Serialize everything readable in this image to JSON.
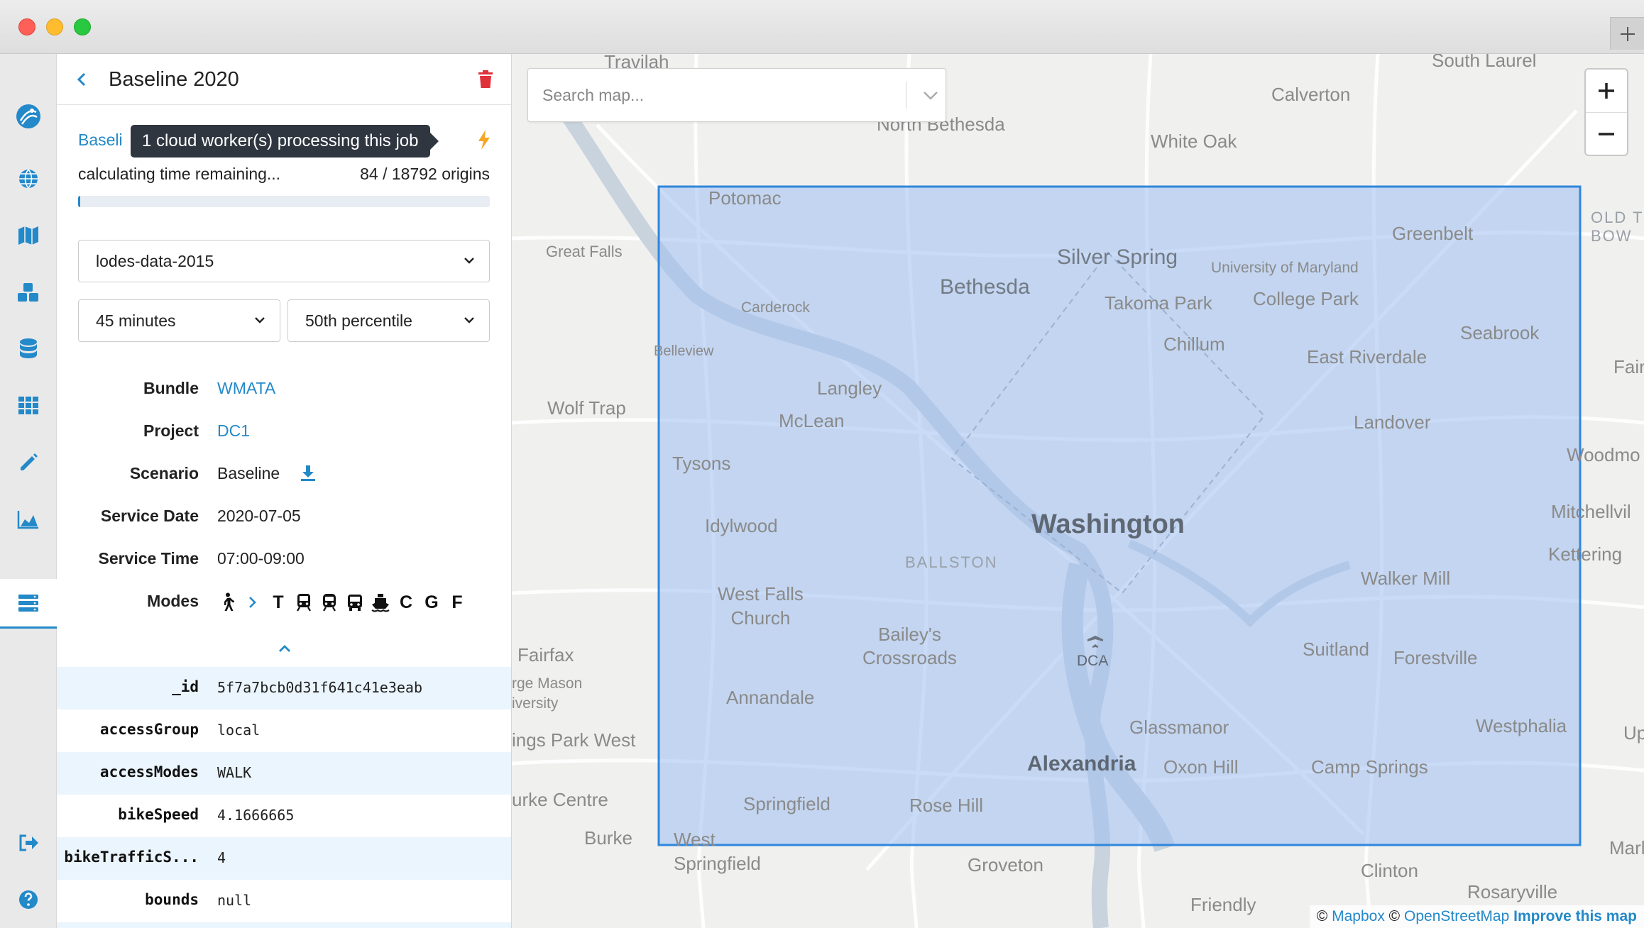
{
  "colors": {
    "accent": "#2389c9",
    "danger": "#e0303a",
    "bolt": "#f5a623",
    "region_fill": "#9ec0f2",
    "region_stroke": "#2f86dd"
  },
  "sidebar": {
    "items": [
      {
        "name": "logo",
        "icon": "logo-icon"
      },
      {
        "name": "regions",
        "icon": "globe-icon"
      },
      {
        "name": "map",
        "icon": "map-icon"
      },
      {
        "name": "bundles",
        "icon": "cubes-icon"
      },
      {
        "name": "database",
        "icon": "database-icon"
      },
      {
        "name": "grid",
        "icon": "grid-icon"
      },
      {
        "name": "edit",
        "icon": "pencil-icon"
      },
      {
        "name": "analysis",
        "icon": "area-chart-icon"
      },
      {
        "name": "jobs",
        "icon": "server-icon",
        "active": true
      },
      {
        "name": "logout",
        "icon": "sign-out-icon"
      },
      {
        "name": "help",
        "icon": "question-circle-icon"
      }
    ]
  },
  "job": {
    "title": "Baseline 2020",
    "link_text": "Baseli",
    "tooltip": "1 cloud worker(s) processing this job",
    "progress_text": "calculating time remaining...",
    "progress_count": "84 / 18792 origins",
    "progress_fraction": 0.0045,
    "opportunity_select": "lodes-data-2015",
    "time_cutoff_select": "45 minutes",
    "percentile_select": "50th percentile"
  },
  "details": {
    "bundle_label": "Bundle",
    "bundle_value": "WMATA",
    "project_label": "Project",
    "project_value": "DC1",
    "scenario_label": "Scenario",
    "scenario_value": "Baseline",
    "service_date_label": "Service Date",
    "service_date_value": "2020-07-05",
    "service_time_label": "Service Time",
    "service_time_value": "07:00-09:00",
    "modes_label": "Modes",
    "modes": [
      "T",
      "C",
      "G",
      "F"
    ]
  },
  "properties": [
    {
      "key": "_id",
      "value": "5f7a7bcb0d31f641c41e3eab"
    },
    {
      "key": "accessGroup",
      "value": "local"
    },
    {
      "key": "accessModes",
      "value": "WALK"
    },
    {
      "key": "bikeSpeed",
      "value": "4.1666665"
    },
    {
      "key": "bikeTrafficS...",
      "value": "4"
    },
    {
      "key": "bounds",
      "value": "null"
    }
  ],
  "map": {
    "search_placeholder": "Search map...",
    "zoom_in": "+",
    "zoom_out": "−",
    "attribution": {
      "c1": "©",
      "mapbox": "Mapbox",
      "c2": "©",
      "osm": "OpenStreetMap",
      "improve": "Improve this map"
    },
    "labels": {
      "travilah": "Travilah",
      "north_bethesda": "North Bethesda",
      "calverton": "Calverton",
      "south_laurel": "South Laurel",
      "white_oak": "White Oak",
      "potomac": "Potomac",
      "great_falls": "Great Falls",
      "silver_spring": "Silver Spring",
      "greenbelt": "Greenbelt",
      "old_town_bowie": "OLD T\nBOW",
      "bethesda": "Bethesda",
      "umd": "University of Maryland",
      "takoma_park": "Takoma Park",
      "college_park": "College Park",
      "carderock": "Carderock",
      "chillum": "Chillum",
      "seabrook": "Seabrook",
      "bellevieew": "Belleview",
      "east_riverdale": "East Riverdale",
      "fair": "Fair",
      "langley": "Langley",
      "wolf_trap": "Wolf Trap",
      "mclean": "McLean",
      "landover": "Landover",
      "tysons": "Tysons",
      "woodmo": "Woodmo",
      "mitchellvil": "Mitchellvil",
      "idylwood": "Idylwood",
      "washington": "Washington",
      "ballston": "BALLSTON",
      "kettering": "Kettering",
      "walker_mill": "Walker Mill",
      "west_falls_church": "West Falls\nChurch",
      "baileys": "Bailey's\nCrossroads",
      "fairfax": "Fairfax",
      "dca": "DCA",
      "suitland": "Suitland",
      "forestville": "Forestville",
      "gmu": "rge Mason\niversity",
      "annandale": "Annandale",
      "glassmanor": "Glassmanor",
      "westphalia": "Westphalia",
      "up": "Up",
      "kings_park_west": "ings Park West",
      "alexandria": "Alexandria",
      "oxon_hill": "Oxon Hill",
      "camp_springs": "Camp Springs",
      "burke_centre": "urke Centre",
      "springfield": "Springfield",
      "rose_hill": "Rose Hill",
      "burke": "Burke",
      "west_springfield": "West\nSpringfield",
      "groveton": "Groveton",
      "clinton": "Clinton",
      "marlton": "Marlton",
      "rosaryville": "Rosaryville",
      "friendly": "Friendly"
    }
  }
}
